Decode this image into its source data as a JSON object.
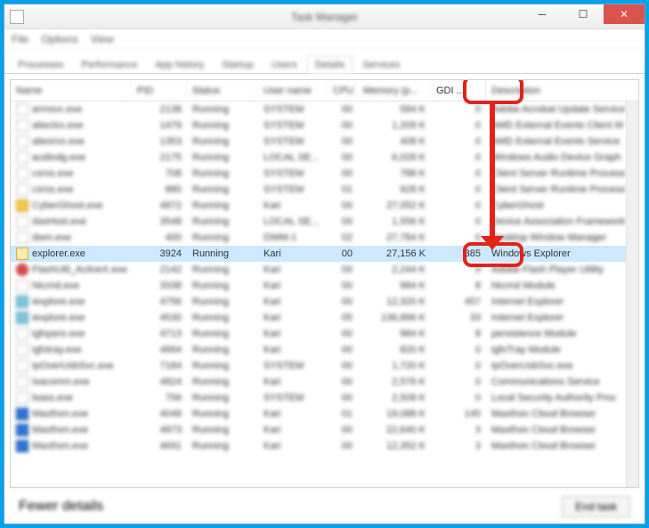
{
  "window": {
    "title": "Task Manager"
  },
  "menu": [
    "File",
    "Options",
    "View"
  ],
  "tabs": [
    "Processes",
    "Performance",
    "App history",
    "Startup",
    "Users",
    "Details",
    "Services"
  ],
  "active_tab": 5,
  "columns": {
    "name": "Name",
    "pid": "PID",
    "status": "Status",
    "user": "User name",
    "cpu": "CPU",
    "memory": "Memory (p...",
    "gdi": "GDI ...",
    "desc": "Description"
  },
  "selected_row": {
    "name": "explorer.exe",
    "pid": "3924",
    "status": "Running",
    "user": "Kari",
    "cpu": "00",
    "memory": "27,156 K",
    "gdi": "385",
    "desc": "Windows Explorer"
  },
  "rows_before": [
    {
      "icon": "ic-white",
      "name": "armsvc.exe",
      "pid": "2138",
      "status": "Running",
      "user": "SYSTEM",
      "cpu": "00",
      "memory": "584 K",
      "gdi": "0",
      "desc": "Adobe Acrobat Update Service"
    },
    {
      "icon": "ic-white",
      "name": "atieclxx.exe",
      "pid": "1479",
      "status": "Running",
      "user": "SYSTEM",
      "cpu": "00",
      "memory": "1,209 K",
      "gdi": "0",
      "desc": "AMD External Events Client M"
    },
    {
      "icon": "ic-white",
      "name": "atiesrxx.exe",
      "pid": "1353",
      "status": "Running",
      "user": "SYSTEM",
      "cpu": "00",
      "memory": "408 K",
      "gdi": "0",
      "desc": "AMD External Events Service"
    },
    {
      "icon": "ic-white",
      "name": "audiodg.exe",
      "pid": "2175",
      "status": "Running",
      "user": "LOCAL SE...",
      "cpu": "00",
      "memory": "6,028 K",
      "gdi": "0",
      "desc": "Windows Audio Device Graph"
    },
    {
      "icon": "ic-white",
      "name": "csrss.exe",
      "pid": "708",
      "status": "Running",
      "user": "SYSTEM",
      "cpu": "00",
      "memory": "788 K",
      "gdi": "0",
      "desc": "Client Server Runtime Process"
    },
    {
      "icon": "ic-white",
      "name": "csrss.exe",
      "pid": "880",
      "status": "Running",
      "user": "SYSTEM",
      "cpu": "01",
      "memory": "928 K",
      "gdi": "0",
      "desc": "Client Server Runtime Process"
    },
    {
      "icon": "ic-yellow",
      "name": "CyberGhost.exe",
      "pid": "4872",
      "status": "Running",
      "user": "Kari",
      "cpu": "00",
      "memory": "27,052 K",
      "gdi": "0",
      "desc": "CyberGhost"
    },
    {
      "icon": "ic-white",
      "name": "dasHost.exe",
      "pid": "3548",
      "status": "Running",
      "user": "LOCAL SE...",
      "cpu": "00",
      "memory": "1,556 K",
      "gdi": "0",
      "desc": "Device Association Framework"
    },
    {
      "icon": "ic-white",
      "name": "dwm.exe",
      "pid": "400",
      "status": "Running",
      "user": "DWM-1",
      "cpu": "02",
      "memory": "27,784 K",
      "gdi": "0",
      "desc": "Desktop Window Manager"
    }
  ],
  "rows_after": [
    {
      "icon": "ic-red",
      "name": "FlashUtil_ActiveX.exe",
      "pid": "2142",
      "status": "Running",
      "user": "Kari",
      "cpu": "00",
      "memory": "2,244 K",
      "gdi": "0",
      "desc": "Adobe Flash Player Utility"
    },
    {
      "icon": "ic-white",
      "name": "hkcmd.exe",
      "pid": "3338",
      "status": "Running",
      "user": "Kari",
      "cpu": "00",
      "memory": "984 K",
      "gdi": "8",
      "desc": "hkcmd Module"
    },
    {
      "icon": "ic-teal",
      "name": "iexplore.exe",
      "pid": "4756",
      "status": "Running",
      "user": "Kari",
      "cpu": "00",
      "memory": "12,320 K",
      "gdi": "457",
      "desc": "Internet Explorer"
    },
    {
      "icon": "ic-teal",
      "name": "iexplore.exe",
      "pid": "4530",
      "status": "Running",
      "user": "Kari",
      "cpu": "05",
      "memory": "136,896 K",
      "gdi": "33",
      "desc": "Internet Explorer"
    },
    {
      "icon": "ic-white",
      "name": "igfxpers.exe",
      "pid": "4713",
      "status": "Running",
      "user": "Kari",
      "cpu": "00",
      "memory": "984 K",
      "gdi": "8",
      "desc": "persistence Module"
    },
    {
      "icon": "ic-white",
      "name": "igfxtray.exe",
      "pid": "4664",
      "status": "Running",
      "user": "Kari",
      "cpu": "00",
      "memory": "820 K",
      "gdi": "0",
      "desc": "igfxTray Module"
    },
    {
      "icon": "ic-white",
      "name": "IpOverUsbSvc.exe",
      "pid": "7184",
      "status": "Running",
      "user": "SYSTEM",
      "cpu": "00",
      "memory": "1,720 K",
      "gdi": "0",
      "desc": "IpOverUsbSvc.exe"
    },
    {
      "icon": "ic-white",
      "name": "isacomm.exe",
      "pid": "4824",
      "status": "Running",
      "user": "Kari",
      "cpu": "00",
      "memory": "2,576 K",
      "gdi": "0",
      "desc": "Communications Service"
    },
    {
      "icon": "ic-white",
      "name": "lsass.exe",
      "pid": "756",
      "status": "Running",
      "user": "SYSTEM",
      "cpu": "00",
      "memory": "2,508 K",
      "gdi": "0",
      "desc": "Local Security Authority Proc"
    },
    {
      "icon": "ic-blue",
      "name": "Maxthon.exe",
      "pid": "4048",
      "status": "Running",
      "user": "Kari",
      "cpu": "01",
      "memory": "19,088 K",
      "gdi": "145",
      "desc": "Maxthon Cloud Browser"
    },
    {
      "icon": "ic-blue",
      "name": "Maxthon.exe",
      "pid": "4873",
      "status": "Running",
      "user": "Kari",
      "cpu": "00",
      "memory": "22,640 K",
      "gdi": "3",
      "desc": "Maxthon Cloud Browser"
    },
    {
      "icon": "ic-blue",
      "name": "Maxthon.exe",
      "pid": "4691",
      "status": "Running",
      "user": "Kari",
      "cpu": "00",
      "memory": "12,352 K",
      "gdi": "3",
      "desc": "Maxthon Cloud Browser"
    }
  ],
  "footer": {
    "fewer": "Fewer details",
    "endtask": "End task"
  }
}
